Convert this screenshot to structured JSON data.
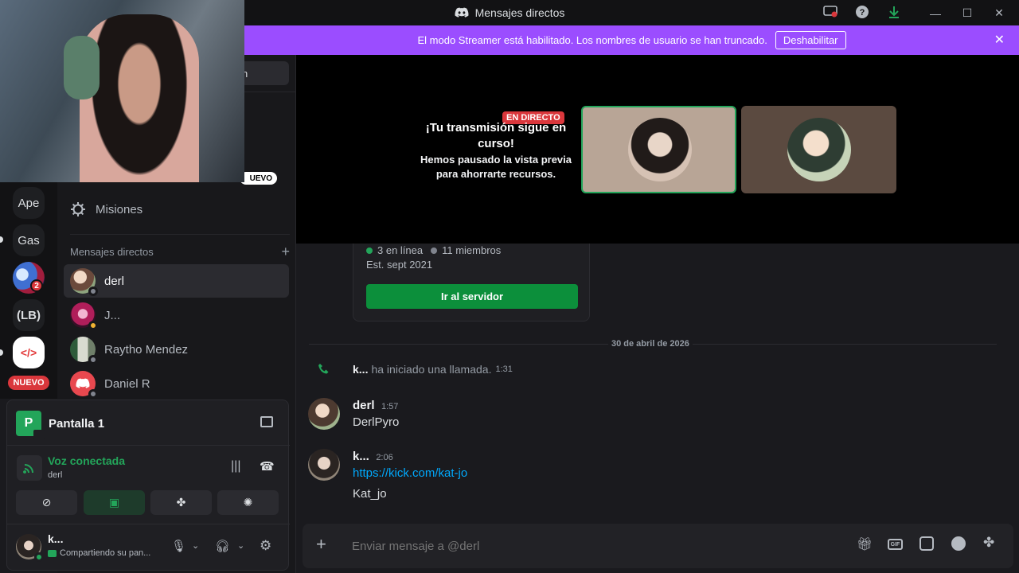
{
  "window": {
    "title": "Mensajes directos"
  },
  "banner": {
    "text": "El modo Streamer está habilitado. Los nombres de usuario se han truncado.",
    "button": "Deshabilitar"
  },
  "servers": [
    {
      "label": "Ape"
    },
    {
      "label": "Gas"
    },
    {
      "label": "",
      "badge": "2"
    },
    {
      "label": "(LB)"
    },
    {
      "label": "</>"
    },
    {
      "label": "",
      "tag": "NUEVO"
    }
  ],
  "sidebar": {
    "search_suffix": "n",
    "new_tag": "UEVO",
    "quests": "Misiones",
    "dm_header": "Mensajes directos",
    "dms": [
      {
        "name": "derl",
        "active": true
      },
      {
        "name": "J..."
      },
      {
        "name": "Raytho Mendez"
      },
      {
        "name": "Daniel R"
      }
    ]
  },
  "voice": {
    "screen_label": "Pantalla 1",
    "status": "Voz conectada",
    "channel": "derl"
  },
  "user": {
    "name": "k...",
    "status": "Compartiendo su pan..."
  },
  "stream": {
    "live_tag": "EN DIRECTO",
    "heading": "¡Tu transmisión sigue en curso!",
    "body": "Hemos pausado la vista previa para ahorrarte recursos."
  },
  "server_card": {
    "online": "3 en línea",
    "members": "11 miembros",
    "established": "Est. sept 2021",
    "button": "Ir al servidor"
  },
  "chat": {
    "date_divider": "30 de abril de 2026",
    "call": {
      "user": "k...",
      "text": "ha iniciado una llamada.",
      "time": "1:31"
    },
    "messages": [
      {
        "author": "derl",
        "time": "1:57",
        "lines": [
          "DerlPyro"
        ]
      },
      {
        "author": "k...",
        "time": "2:06",
        "link": "https://kick.com/kat-jo",
        "lines": [
          "Kat_jo"
        ]
      }
    ]
  },
  "composer": {
    "placeholder": "Enviar mensaje a @derl"
  },
  "colors": {
    "accent": "#5865f2",
    "green": "#23a55a",
    "banner": "#9b4dff",
    "link": "#00a8fc"
  }
}
